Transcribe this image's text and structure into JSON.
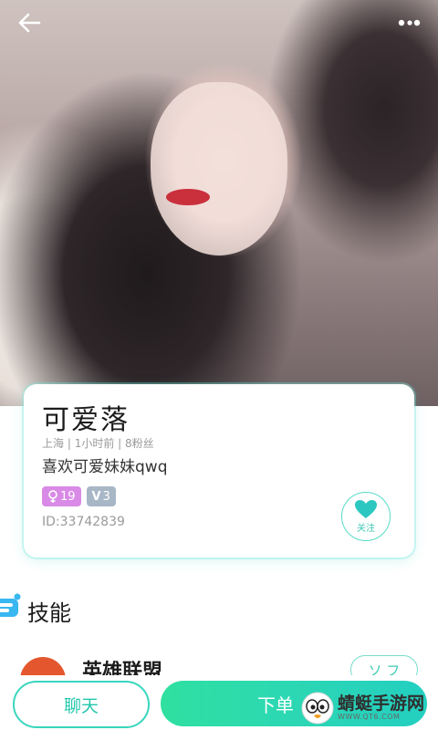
{
  "profile": {
    "name": "可爱落",
    "location": "上海",
    "last_active": "1小时前",
    "fans": "8粉丝",
    "bio": "喜欢可爱妹妹qwq",
    "gender_age": "19",
    "vip_level": "3",
    "vip_letter": "V",
    "user_id": "ID:33742839",
    "follow_label": "关注"
  },
  "section": {
    "title": "技能"
  },
  "skills": [
    {
      "name": "英雄联盟",
      "action": "ソ フ"
    }
  ],
  "actions": {
    "chat": "聊天",
    "order": "下单"
  },
  "watermark": {
    "brand": "蜻蜓手游网",
    "url": "WWW.QT6.COM"
  },
  "colors": {
    "accent": "#2cd7b4",
    "accent_border": "#39d6bd",
    "gender_tag": "#d98ae6",
    "vip_tag": "#a8b7c6",
    "skill_avatar": "#e4572e"
  },
  "icons": {
    "back": "arrow-left-icon",
    "more": "more-dots-icon",
    "follow": "heart-icon",
    "gender": "female-icon",
    "section": "skill-icon"
  }
}
